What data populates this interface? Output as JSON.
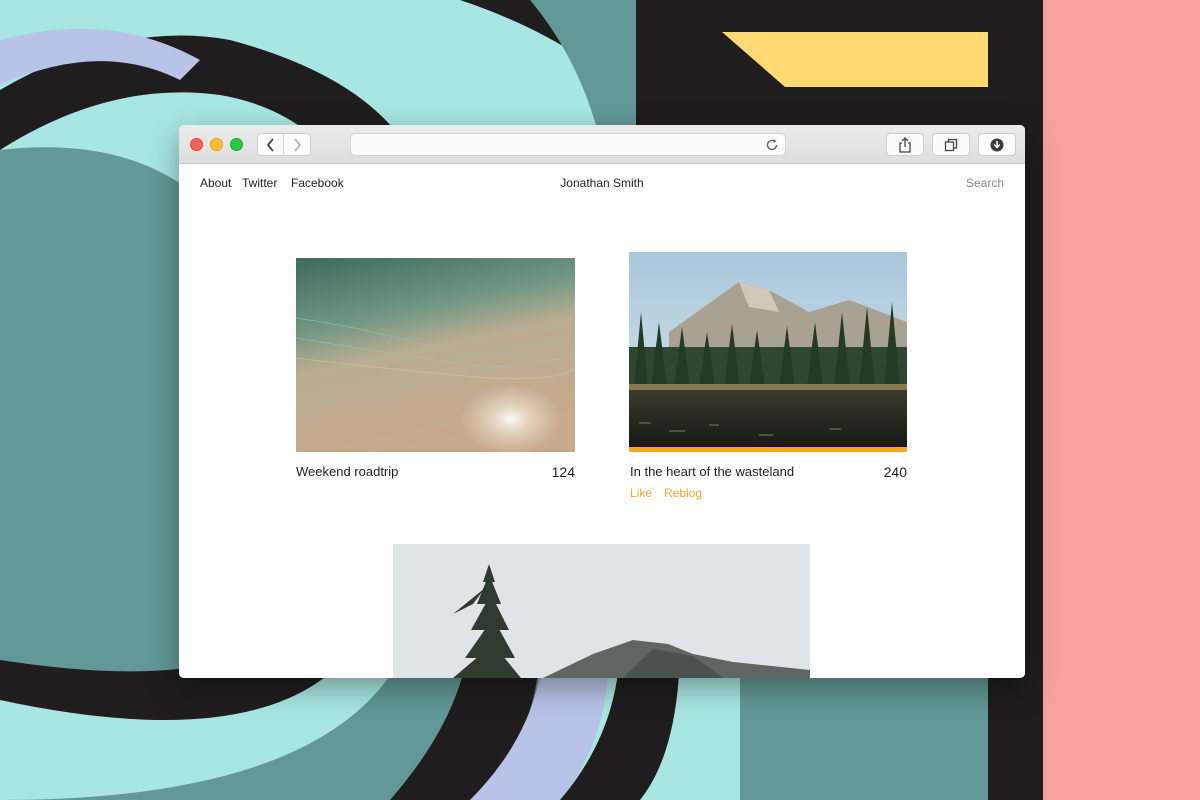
{
  "browser": {
    "url_value": "",
    "buttons": {
      "back": "chevron-left-icon",
      "forward": "chevron-right-icon",
      "reload": "reload-icon",
      "share": "share-icon",
      "tabs": "tabs-icon",
      "downloads": "download-icon"
    }
  },
  "nav": {
    "links": [
      "About",
      "Twitter",
      "Facebook"
    ],
    "site_title": "Jonathan Smith",
    "search_label": "Search"
  },
  "posts": [
    {
      "title": "Weekend roadtrip",
      "count": "124",
      "image": "shallow water over sand photo"
    },
    {
      "title": "In the heart of the wasteland",
      "count": "240",
      "image": "mountain lake forest photo",
      "actions": [
        "Like",
        "Reblog"
      ]
    },
    {
      "title": "",
      "image": "misty pine tree and mountain photo"
    }
  ],
  "colors": {
    "accent": "#f5a623",
    "bg_teal": "#629895",
    "bg_aqua": "#a8e6e1",
    "bg_lavender": "#b9c3e8",
    "bg_dark": "#1f1d1e",
    "bg_yellow": "#ffd972",
    "bg_pink": "#f7a09c"
  }
}
